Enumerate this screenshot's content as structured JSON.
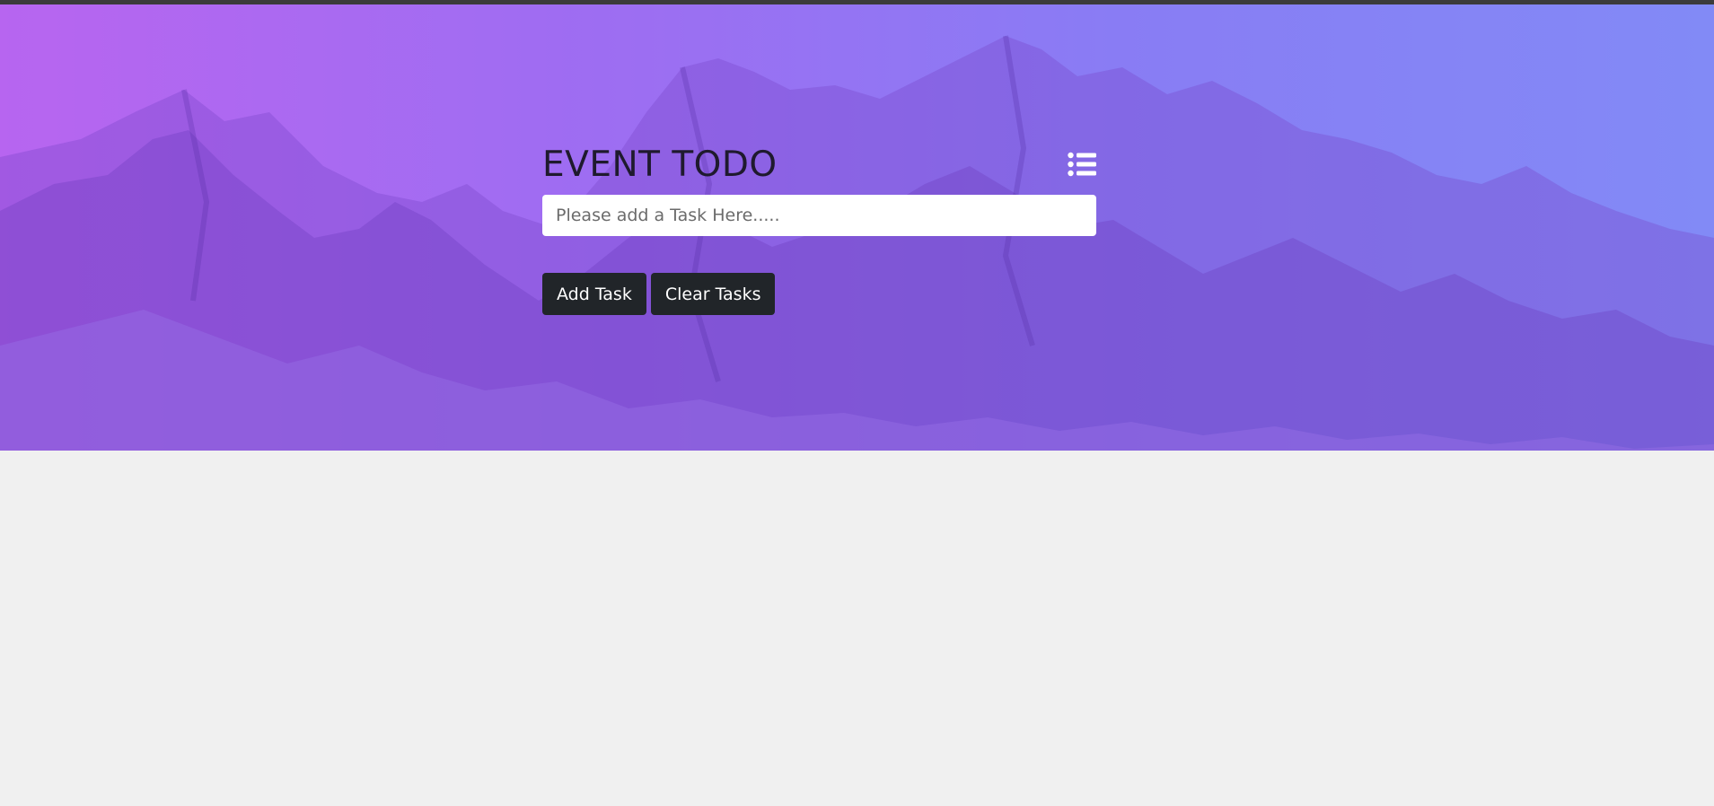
{
  "app": {
    "title": "EVENT TODO"
  },
  "header": {
    "menu_icon": "list-icon"
  },
  "task_input": {
    "value": "",
    "placeholder": "Please add a Task Here....."
  },
  "buttons": {
    "add_label": "Add Task",
    "clear_label": "Clear Tasks"
  },
  "colors": {
    "gradient_left": "#b55ff0",
    "gradient_right": "#7d86f6",
    "button_bg": "#212529",
    "page_bg": "#f0f0f0"
  }
}
